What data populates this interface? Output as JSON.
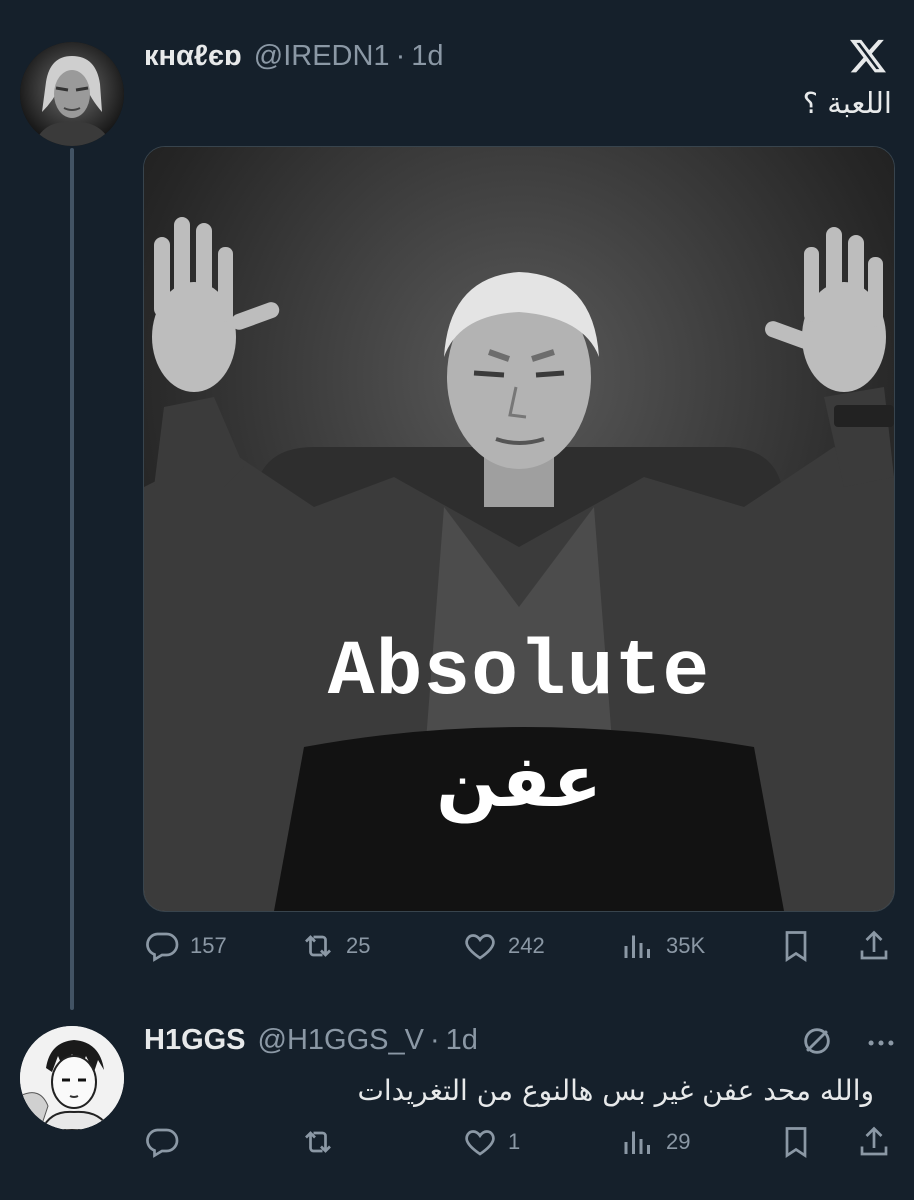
{
  "tweet1": {
    "name": "кнαℓєɒ",
    "handle": "@IREDN1",
    "separator": "·",
    "time": "1d",
    "text": "اللعبة ؟",
    "media": {
      "overlay_text_en": "Absolute",
      "overlay_text_ar": "عفن"
    },
    "actions": {
      "replies": "157",
      "reposts": "25",
      "likes": "242",
      "views": "35K"
    }
  },
  "tweet2": {
    "name": "H1GGS",
    "handle": "@H1GGS_V",
    "separator": "·",
    "time": "1d",
    "text": "والله محد عفن غير بس هالنوع من التغريدات",
    "actions": {
      "replies": "",
      "reposts": "",
      "likes": "1",
      "views": "29"
    }
  },
  "icons": {
    "brand": "x-logo-icon",
    "reply": "reply-icon",
    "repost": "repost-icon",
    "like": "heart-icon",
    "views": "views-icon",
    "bookmark": "bookmark-icon",
    "share": "share-icon",
    "hidden": "no-sign-icon",
    "more": "more-icon"
  },
  "colors": {
    "background": "#15202b",
    "text": "#e7e9ea",
    "muted": "#8b98a5",
    "thread_line": "#425364"
  }
}
